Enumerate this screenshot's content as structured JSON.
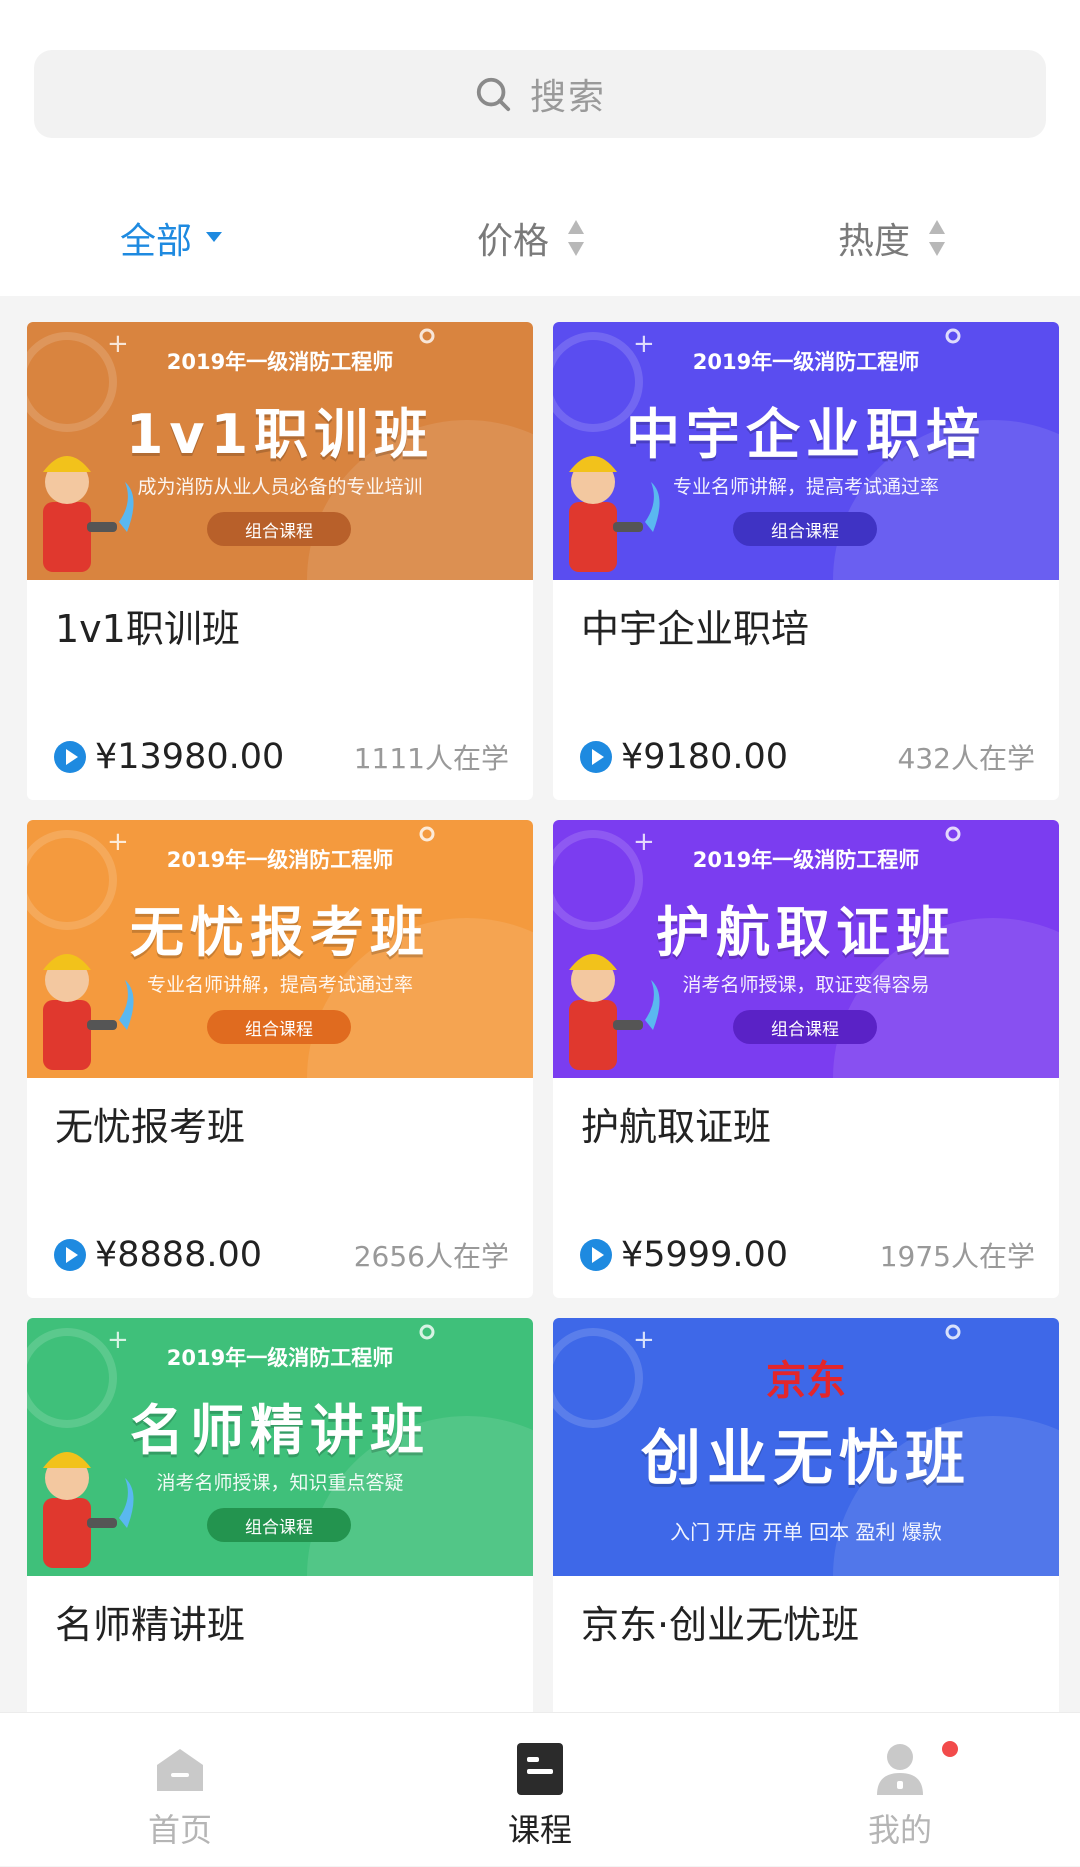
{
  "search": {
    "placeholder": "搜索"
  },
  "filters": [
    {
      "label": "全部",
      "active": true
    },
    {
      "label": "价格",
      "active": false
    },
    {
      "label": "热度",
      "active": false
    }
  ],
  "courses": [
    {
      "banner_top": "2019年一级消防工程师",
      "banner_title": "1v1职训班",
      "banner_sub": "成为消防从业人员必备的专业培训",
      "banner_tag": "组合课程",
      "title": "1v1职训班",
      "price": "¥13980.00",
      "learners": "1111人在学",
      "theme": "#d9843f",
      "tag_color": "#b8602a"
    },
    {
      "banner_top": "2019年一级消防工程师",
      "banner_title": "中宇企业职培",
      "banner_sub": "专业名师讲解，提高考试通过率",
      "banner_tag": "组合课程",
      "title": "中宇企业职培",
      "price": "¥9180.00",
      "learners": "432人在学",
      "theme": "#5a4df0",
      "tag_color": "#3f33c4"
    },
    {
      "banner_top": "2019年一级消防工程师",
      "banner_title": "无忧报考班",
      "banner_sub": "专业名师讲解，提高考试通过率",
      "banner_tag": "组合课程",
      "title": "无忧报考班",
      "price": "¥8888.00",
      "learners": "2656人在学",
      "theme": "#f49a3e",
      "tag_color": "#e06b1f"
    },
    {
      "banner_top": "2019年一级消防工程师",
      "banner_title": "护航取证班",
      "banner_sub": "消考名师授课，取证变得容易",
      "banner_tag": "组合课程",
      "title": "护航取证班",
      "price": "¥5999.00",
      "learners": "1975人在学",
      "theme": "#7b3df0",
      "tag_color": "#5a22c6"
    },
    {
      "banner_top": "2019年一级消防工程师",
      "banner_title": "名师精讲班",
      "banner_sub": "消考名师授课，知识重点答疑",
      "banner_tag": "组合课程",
      "title": "名师精讲班",
      "price": "",
      "learners": "",
      "theme": "#3fc07a",
      "tag_color": "#23944f"
    },
    {
      "banner_top": "京东",
      "banner_title": "创业无忧班",
      "banner_sub": "入门 开店 开单 回本 盈利 爆款",
      "banner_tag": "",
      "title": "京东·创业无忧班",
      "price": "",
      "learners": "",
      "theme": "#3e68e8",
      "tag_color": ""
    }
  ],
  "tabbar": [
    {
      "label": "首页",
      "icon": "home-icon",
      "active": false
    },
    {
      "label": "课程",
      "icon": "course-icon",
      "active": true
    },
    {
      "label": "我的",
      "icon": "profile-icon",
      "active": false
    }
  ],
  "colors": {
    "accent": "#1e8ae0",
    "badge": "#f24b4b"
  }
}
